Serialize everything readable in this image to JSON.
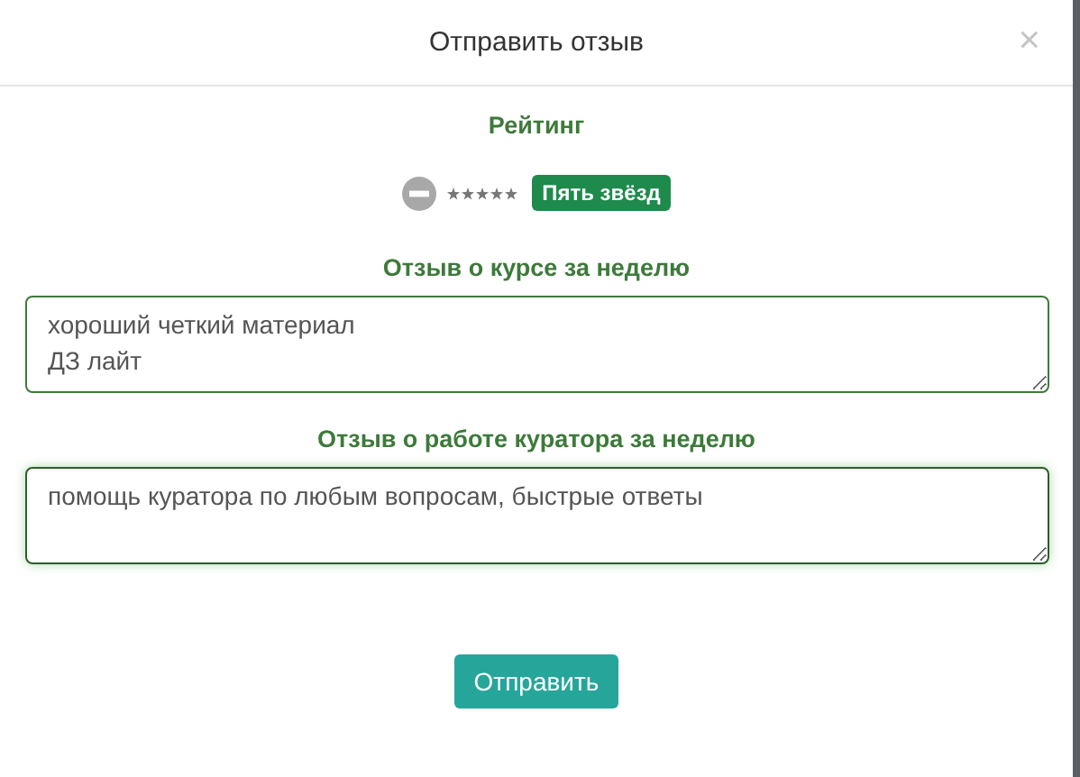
{
  "modal": {
    "title": "Отправить отзыв",
    "close": "×"
  },
  "rating": {
    "label": "Рейтинг",
    "stars": 5,
    "caption": "Пять звёзд"
  },
  "fields": [
    {
      "label": "Отзыв о курсе за неделю",
      "value": "хороший четкий материал\nДЗ лайт",
      "focused": false
    },
    {
      "label": "Отзыв о работе куратора за неделю",
      "value": "помощь куратора по любым вопросам, быстрые ответы",
      "focused": true
    }
  ],
  "submit": "Отправить"
}
